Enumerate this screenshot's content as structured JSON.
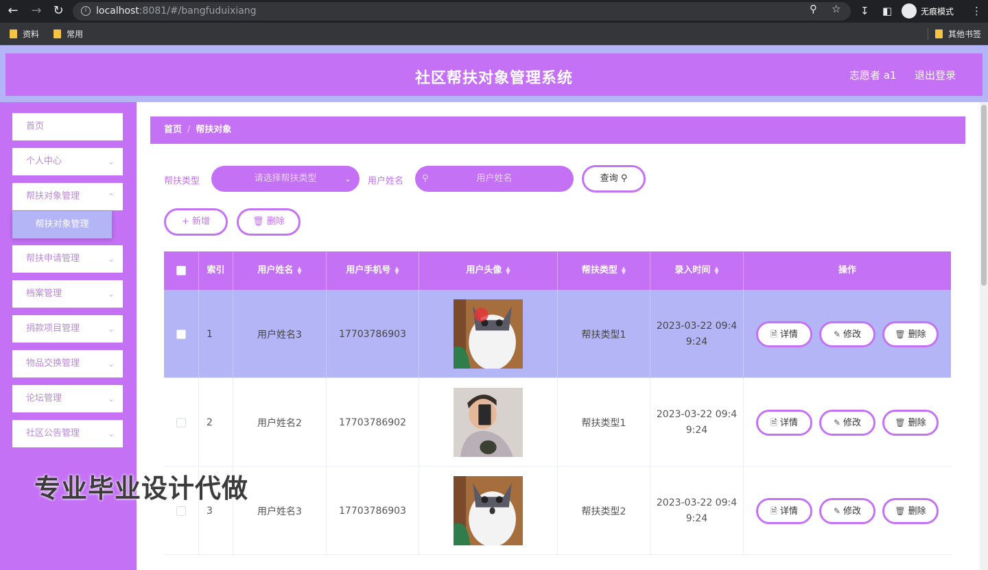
{
  "browser": {
    "url_host": "localhost",
    "url_rest": ":8081/#/bangfuduixiang",
    "incognito_label": "无痕模式",
    "bookmarks": [
      "资料",
      "常用"
    ],
    "other_bookmarks": "其他书签"
  },
  "header": {
    "title": "社区帮扶对象管理系统",
    "user": "志愿者 a1",
    "logout": "退出登录"
  },
  "sidebar": {
    "items": [
      {
        "label": "首页",
        "has_children": false
      },
      {
        "label": "个人中心",
        "has_children": true
      },
      {
        "label": "帮扶对象管理",
        "has_children": true
      },
      {
        "label": "帮扶申请管理",
        "has_children": true
      },
      {
        "label": "档案管理",
        "has_children": true
      },
      {
        "label": "捐款项目管理",
        "has_children": true
      },
      {
        "label": "物品交换管理",
        "has_children": true
      },
      {
        "label": "论坛管理",
        "has_children": true
      },
      {
        "label": "社区公告管理",
        "has_children": true
      }
    ],
    "active_sub": "帮扶对象管理"
  },
  "breadcrumb": {
    "home": "首页",
    "sep": "/",
    "current": "帮扶对象"
  },
  "search": {
    "type_label": "帮扶类型",
    "type_placeholder": "请选择帮扶类型",
    "name_label": "用户姓名",
    "name_placeholder": "用户姓名",
    "query_button": "查询"
  },
  "actions": {
    "add": "新增",
    "delete": "删除"
  },
  "table": {
    "columns": [
      "索引",
      "用户姓名",
      "用户手机号",
      "用户头像",
      "帮扶类型",
      "录入时间",
      "操作"
    ],
    "rows": [
      {
        "index": "1",
        "name": "用户姓名3",
        "phone": "17703786903",
        "type": "帮扶类型1",
        "time_line1": "2023-03-22 09:4",
        "time_line2": "9:24",
        "selected": true
      },
      {
        "index": "2",
        "name": "用户姓名2",
        "phone": "17703786902",
        "type": "帮扶类型1",
        "time_line1": "2023-03-22 09:4",
        "time_line2": "9:24",
        "selected": false
      },
      {
        "index": "3",
        "name": "用户姓名3",
        "phone": "17703786903",
        "type": "帮扶类型2",
        "time_line1": "2023-03-22 09:4",
        "time_line2": "9:24",
        "selected": false
      }
    ],
    "op_detail": "详情",
    "op_edit": "修改",
    "op_delete": "删除"
  },
  "watermark": "专业毕业设计代做",
  "colors": {
    "accent": "#c471f5",
    "accent_light": "#b4b5f6"
  }
}
